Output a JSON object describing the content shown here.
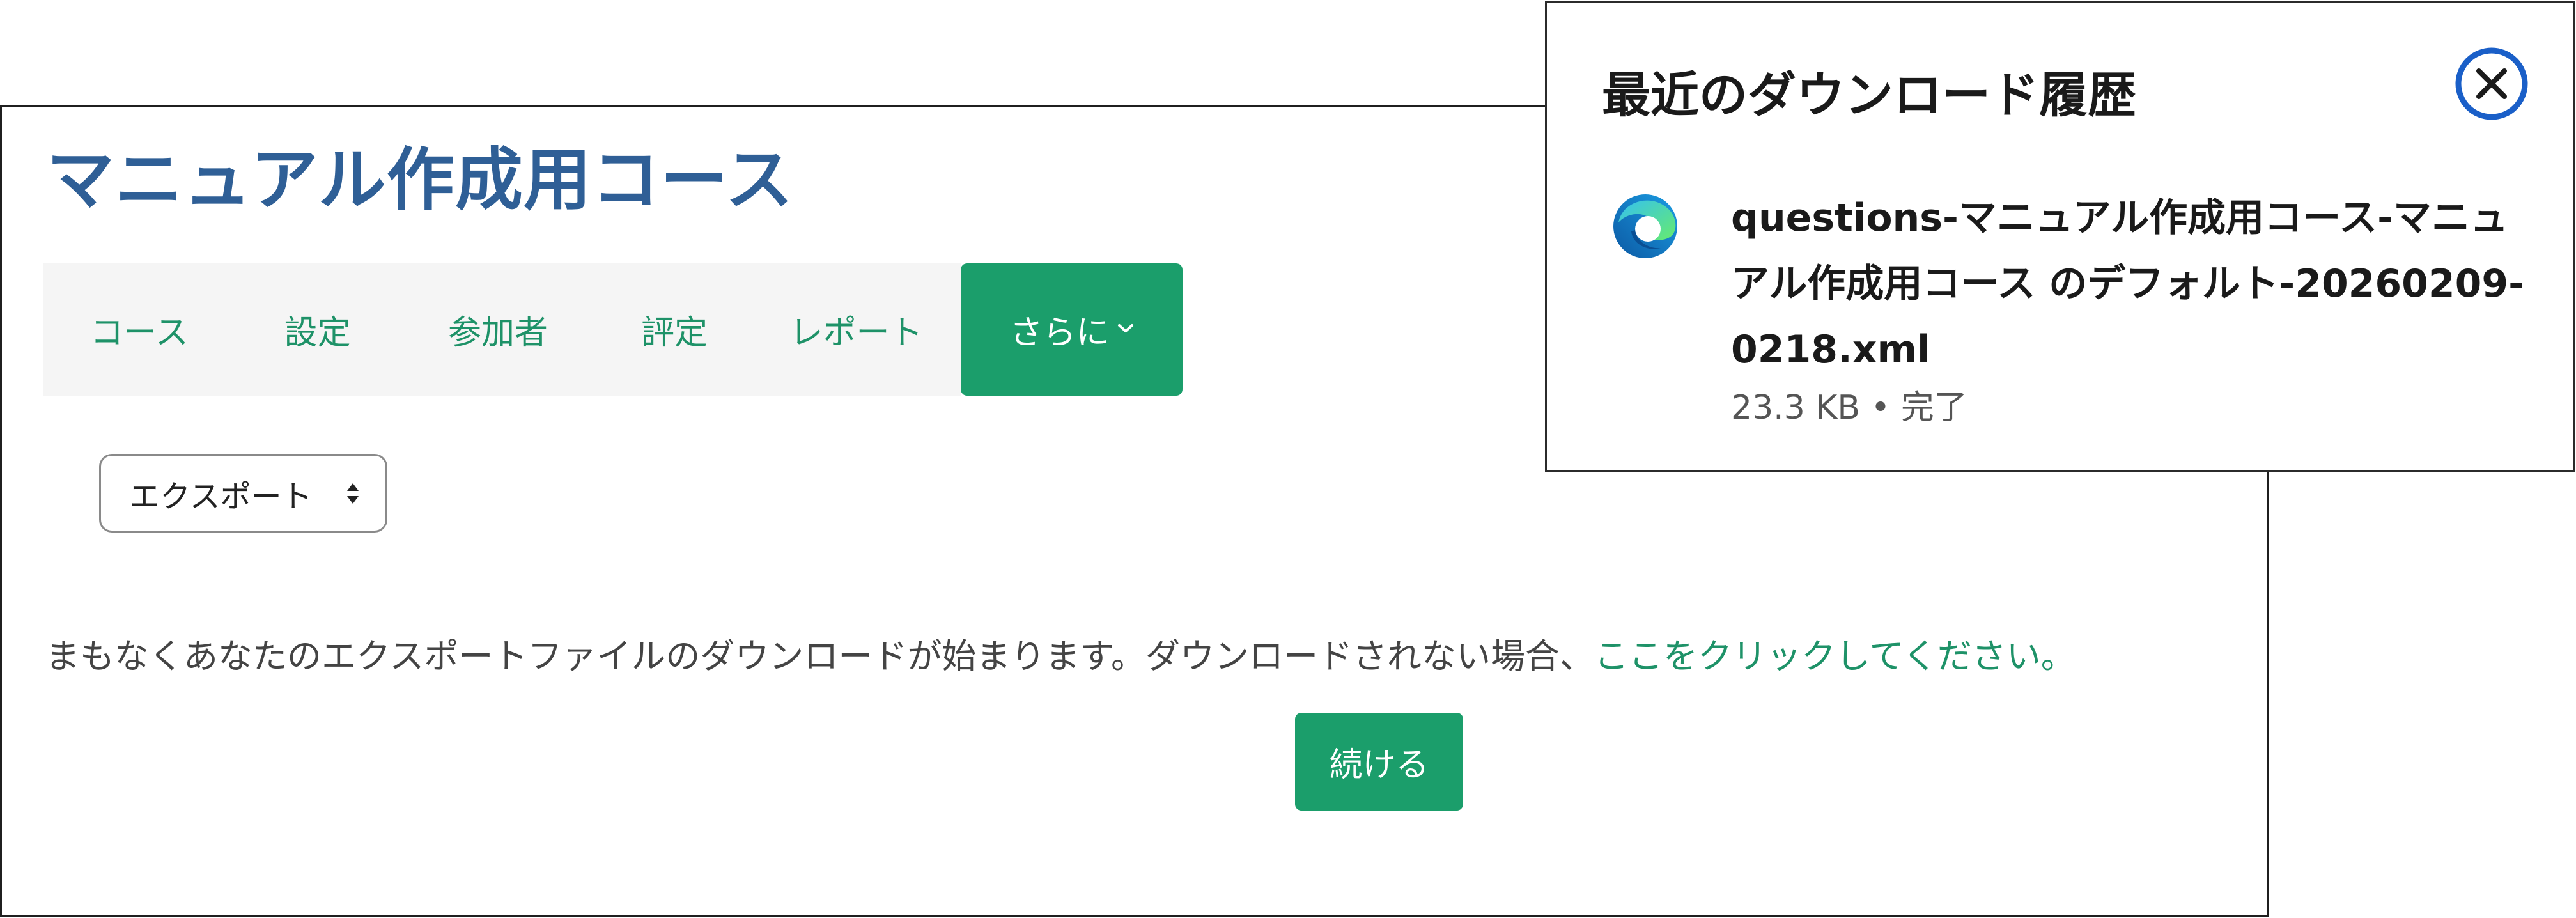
{
  "course": {
    "title": "マニュアル作成用コース"
  },
  "nav": {
    "items": [
      {
        "label": "コース"
      },
      {
        "label": "設定"
      },
      {
        "label": "参加者"
      },
      {
        "label": "評定"
      },
      {
        "label": "レポート"
      }
    ],
    "more_label": "さらに",
    "more_icon": "chevron-down-icon"
  },
  "export_select": {
    "value": "エクスポート",
    "icon": "sort-icon"
  },
  "message": {
    "text": "まもなくあなたのエクスポートファイルのダウンロードが始まります。ダウンロードされない場合、",
    "link_text": "ここをクリックしてください。"
  },
  "continue_button": {
    "label": "続ける"
  },
  "download_popup": {
    "title": "最近のダウンロード履歴",
    "close_icon": "close-icon",
    "browser_icon": "edge-icon",
    "file_name": "questions-マニュアル作成用コース-マニュアル作成用コース のデフォルト-20260209-0218.xml",
    "file_meta": "23.3 KB • 完了"
  },
  "colors": {
    "title_blue": "#2f5f96",
    "accent_green": "#1b9e6b",
    "link_green": "#1e9268",
    "close_blue": "#1a5fc8"
  }
}
